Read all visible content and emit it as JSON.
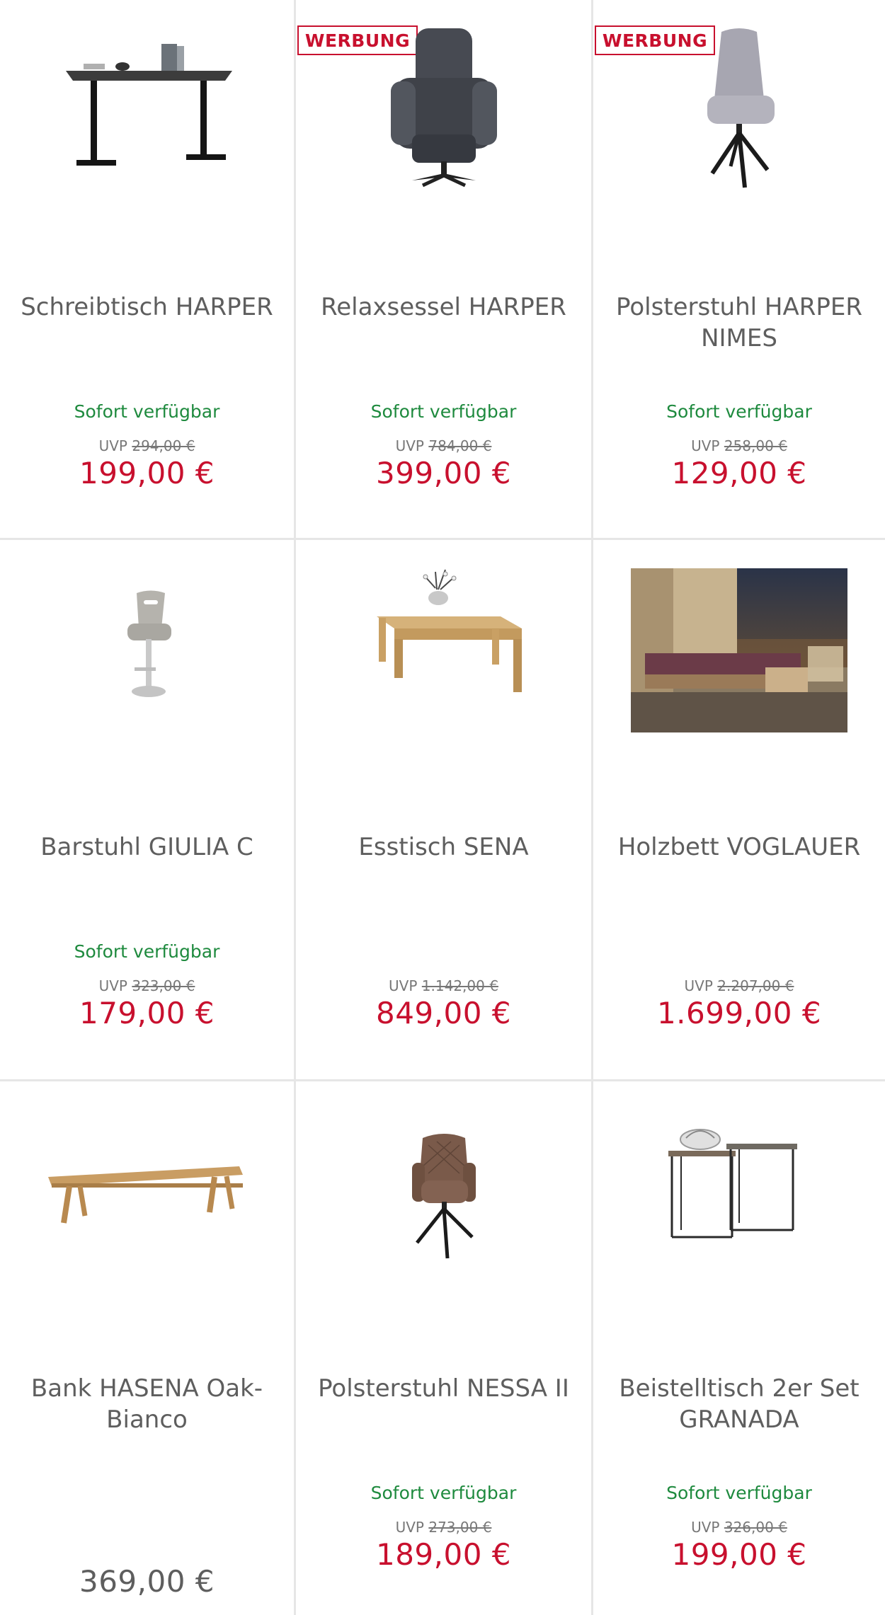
{
  "products": [
    {
      "badge": "",
      "title": "Schreibtisch HARPER",
      "availability": "Sofort verfügbar",
      "uvp_label": "UVP",
      "uvp_price": "294,00 €",
      "price": "199,00 €"
    },
    {
      "badge": "WERBUNG",
      "title": "Relaxsessel HARPER",
      "availability": "Sofort verfügbar",
      "uvp_label": "UVP",
      "uvp_price": "784,00 €",
      "price": "399,00 €"
    },
    {
      "badge": "WERBUNG",
      "title": "Polsterstuhl HARPER NIMES",
      "availability": "Sofort verfügbar",
      "uvp_label": "UVP",
      "uvp_price": "258,00 €",
      "price": "129,00 €"
    },
    {
      "badge": "",
      "title": "Barstuhl GIULIA C",
      "availability": "Sofort verfügbar",
      "uvp_label": "UVP",
      "uvp_price": "323,00 €",
      "price": "179,00 €"
    },
    {
      "badge": "",
      "title": "Esstisch SENA",
      "availability": "",
      "uvp_label": "UVP",
      "uvp_price": "1.142,00 €",
      "price": "849,00 €"
    },
    {
      "badge": "",
      "title": "Holzbett VOGLAUER",
      "availability": "",
      "uvp_label": "UVP",
      "uvp_price": "2.207,00 €",
      "price": "1.699,00 €"
    },
    {
      "badge": "",
      "title": "Bank HASENA Oak-Bianco",
      "availability": "",
      "uvp_label": "",
      "uvp_price": "",
      "price": "369,00 €"
    },
    {
      "badge": "",
      "title": "Polsterstuhl NESSA II",
      "availability": "Sofort verfügbar",
      "uvp_label": "UVP",
      "uvp_price": "273,00 €",
      "price": "189,00 €"
    },
    {
      "badge": "",
      "title": "Beistelltisch 2er Set GRANADA",
      "availability": "Sofort verfügbar",
      "uvp_label": "UVP",
      "uvp_price": "326,00 €",
      "price": "199,00 €"
    }
  ],
  "images": [
    "desk-image",
    "relax-armchair-image",
    "upholstered-chair-image",
    "bar-stool-image",
    "dining-table-image",
    "wooden-bed-image",
    "bench-image",
    "upholstered-chair-brown-image",
    "side-table-set-image"
  ],
  "colors": {
    "price_red": "#c8102e",
    "availability_green": "#1e8a3e",
    "divider": "#e6e6e6",
    "text_gray": "#5e5e5e"
  }
}
